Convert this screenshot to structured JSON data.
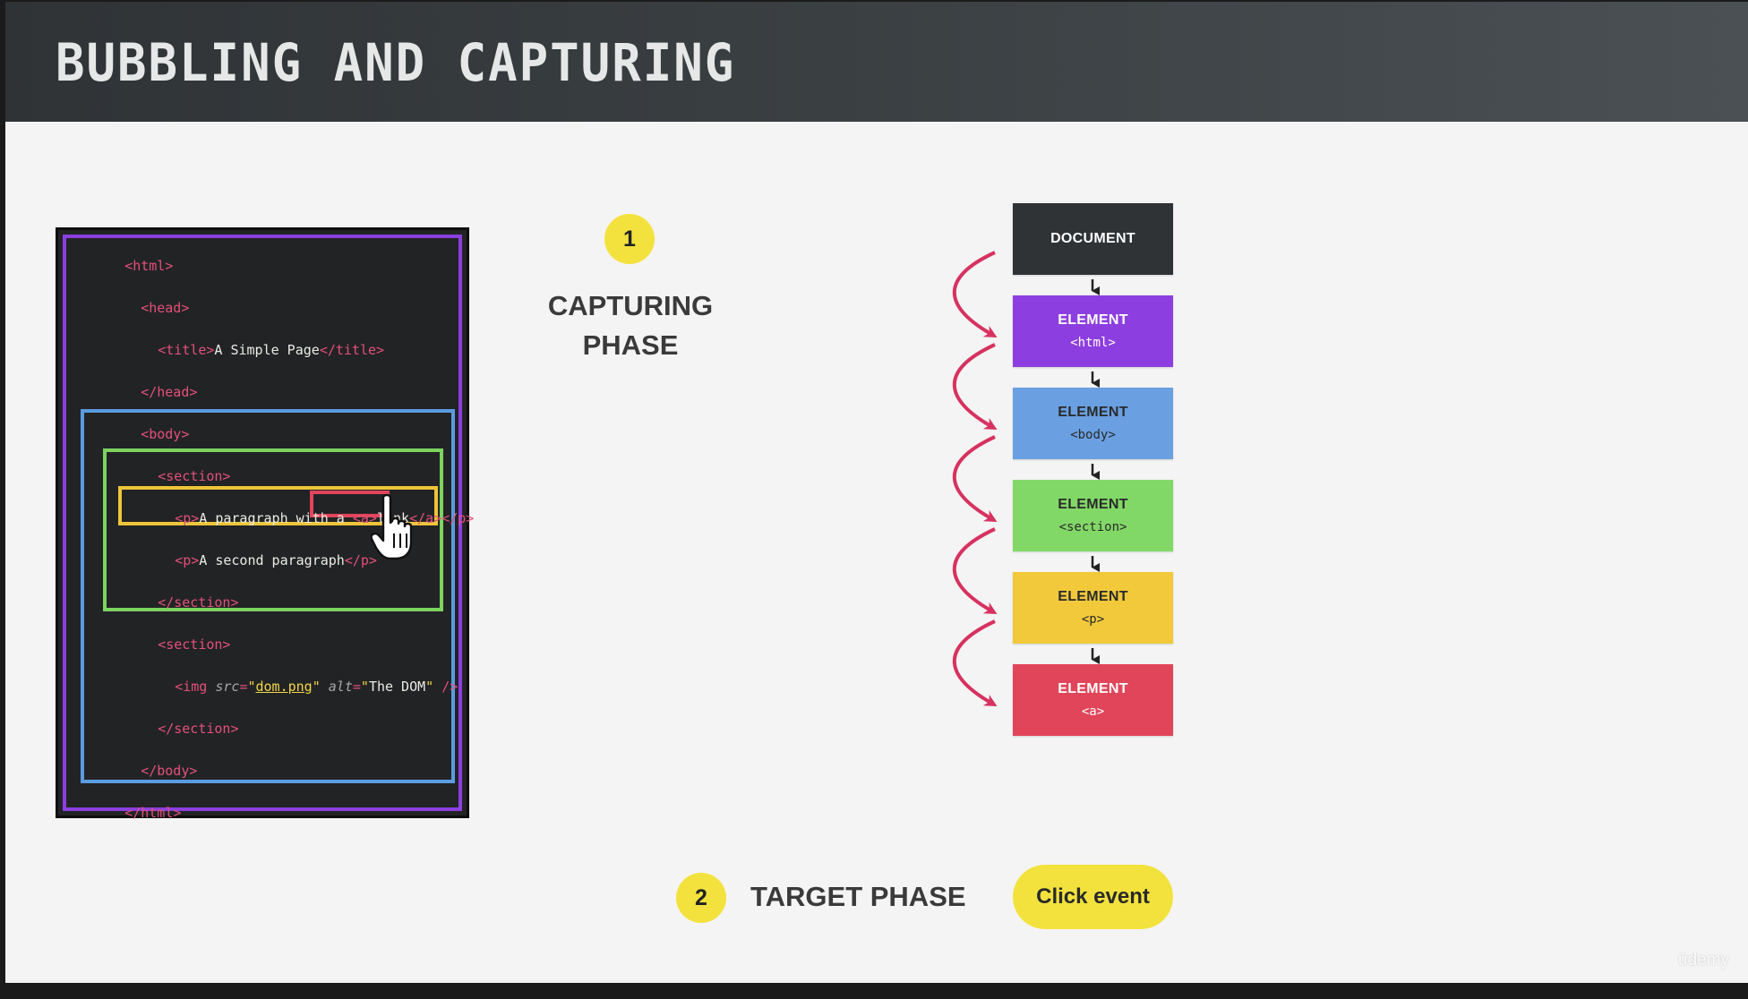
{
  "slide": {
    "title": "BUBBLING AND CAPTURING",
    "watermark": "ūdemy"
  },
  "code": {
    "html_open": "<html>",
    "head_open": "<head>",
    "title_open": "<title>",
    "title_text": "A Simple Page",
    "title_close": "</title>",
    "head_close": "</head>",
    "body_open": "<body>",
    "section_open": "<section>",
    "p_open": "<p>",
    "p1_text": "A paragraph with a ",
    "a_open": "<a>",
    "a_text": "link",
    "a_close": "</a>",
    "p_close": "</p>",
    "p2_text": "A second paragraph",
    "section_close": "</section>",
    "img_open": "<img ",
    "src_attr": "src",
    "src_val": "dom.png",
    "alt_attr": "alt",
    "alt_val": "The DOM",
    "img_close": " />",
    "body_close": "</body>",
    "html_close": "</html>",
    "eq": "=",
    "quote": "\"",
    "space": " "
  },
  "phases": {
    "capturing": {
      "number": "1",
      "line1": "CAPTURING",
      "line2": "PHASE"
    },
    "target": {
      "number": "2",
      "label": "TARGET PHASE"
    }
  },
  "flow": {
    "nodes": [
      {
        "title": "DOCUMENT",
        "tag": "",
        "color": "#2f3336",
        "text_color": "#ffffff"
      },
      {
        "title": "ELEMENT",
        "tag": "<html>",
        "color": "#8d3ee0",
        "text_color": "#ffffff"
      },
      {
        "title": "ELEMENT",
        "tag": "<body>",
        "color": "#6aa0e2",
        "text_color": "#2a2a2a"
      },
      {
        "title": "ELEMENT",
        "tag": "<section>",
        "color": "#82d867",
        "text_color": "#2a2a2a"
      },
      {
        "title": "ELEMENT",
        "tag": "<p>",
        "color": "#f1c93b",
        "text_color": "#2a2a2a"
      },
      {
        "title": "ELEMENT",
        "tag": "<a>",
        "color": "#e1455a",
        "text_color": "#ffffff"
      }
    ],
    "click_event": "Click event",
    "arrow_color": "#d7325f"
  },
  "colors": {
    "html_box": "#8c3fe0",
    "body_box": "#5b9be0",
    "section_box": "#7dd35f",
    "p_box": "#eec43a",
    "a_box": "#e1455a",
    "badge": "#f3e23d"
  }
}
